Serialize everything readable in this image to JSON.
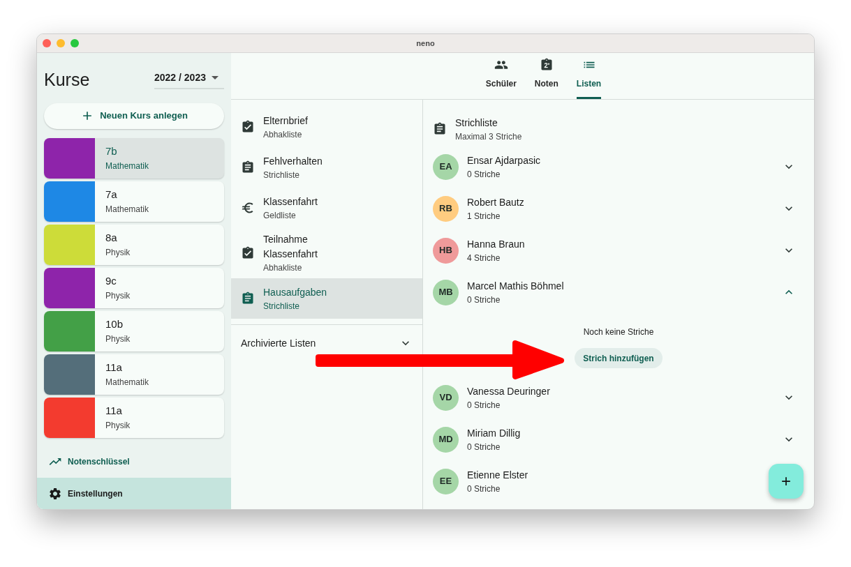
{
  "window": {
    "title": "neno"
  },
  "sidebar": {
    "title": "Kurse",
    "year": "2022 / 2023",
    "new_course": "Neuen Kurs anlegen",
    "courses": [
      {
        "name": "7b",
        "subject": "Mathematik",
        "color": "#8e24aa",
        "selected": true
      },
      {
        "name": "7a",
        "subject": "Mathematik",
        "color": "#1e88e5",
        "selected": false
      },
      {
        "name": "8a",
        "subject": "Physik",
        "color": "#cddc39",
        "selected": false
      },
      {
        "name": "9c",
        "subject": "Physik",
        "color": "#8e24aa",
        "selected": false
      },
      {
        "name": "10b",
        "subject": "Physik",
        "color": "#43a047",
        "selected": false
      },
      {
        "name": "11a",
        "subject": "Mathematik",
        "color": "#546e7a",
        "selected": false
      },
      {
        "name": "11a",
        "subject": "Physik",
        "color": "#f33b2f",
        "selected": false
      }
    ],
    "grade_key": "Notenschlüssel",
    "settings": "Einstellungen"
  },
  "tabs": [
    {
      "label": "Schüler",
      "kind": "people",
      "selected": false
    },
    {
      "label": "Noten",
      "kind": "grade",
      "selected": false
    },
    {
      "label": "Listen",
      "kind": "list",
      "selected": true
    }
  ],
  "lists": [
    {
      "title": "Elternbrief",
      "type": "Abhakliste",
      "kind": "check",
      "selected": false
    },
    {
      "title": "Fehlverhalten",
      "type": "Strichliste",
      "kind": "tally",
      "selected": false
    },
    {
      "title": "Klassenfahrt",
      "type": "Geldliste",
      "kind": "money",
      "selected": false
    },
    {
      "title": "Teilnahme Klassenfahrt",
      "type": "Abhakliste",
      "kind": "check",
      "selected": false
    },
    {
      "title": "Hausaufgaben",
      "type": "Strichliste",
      "kind": "tally",
      "selected": true
    }
  ],
  "archived": "Archivierte Listen",
  "detail": {
    "title": "Strichliste",
    "subtitle": "Maximal 3 Striche",
    "students": [
      {
        "initials": "EA",
        "name": "Ensar Ajdarpasic",
        "count": "0 Striche",
        "color": "#a5d6a7",
        "expanded": false
      },
      {
        "initials": "RB",
        "name": "Robert Bautz",
        "count": "1 Striche",
        "color": "#ffcc80",
        "expanded": false
      },
      {
        "initials": "HB",
        "name": "Hanna Braun",
        "count": "4 Striche",
        "color": "#ef9a9a",
        "expanded": false
      },
      {
        "initials": "MB",
        "name": "Marcel Mathis Böhmel",
        "count": "0 Striche",
        "color": "#a5d6a7",
        "expanded": true,
        "empty_text": "Noch keine Striche",
        "add_button": "Strich hinzufügen"
      },
      {
        "initials": "VD",
        "name": "Vanessa Deuringer",
        "count": "0 Striche",
        "color": "#a5d6a7",
        "expanded": false
      },
      {
        "initials": "MD",
        "name": "Miriam Dillig",
        "count": "0 Striche",
        "color": "#a5d6a7",
        "expanded": false
      },
      {
        "initials": "EE",
        "name": "Etienne Elster",
        "count": "0 Striche",
        "color": "#a5d6a7"
      }
    ]
  },
  "fab": "+"
}
